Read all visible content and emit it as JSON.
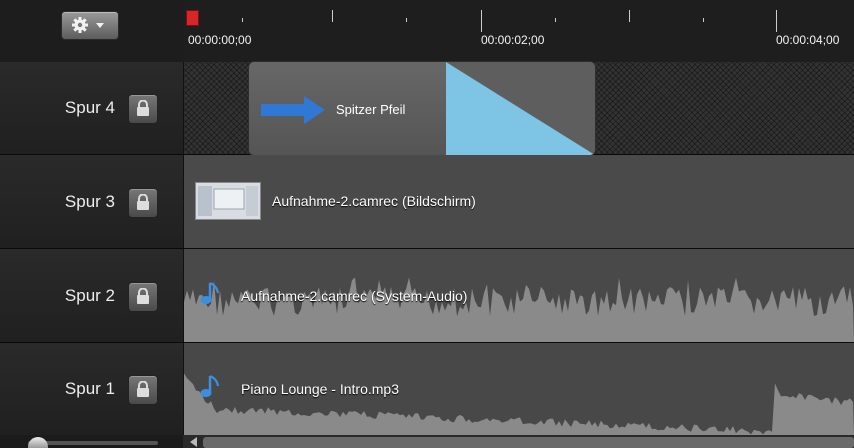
{
  "ruler": {
    "labels": [
      "00:00:00;00",
      "00:00:02;00",
      "00:00:04;00"
    ]
  },
  "tracks": [
    {
      "label": "Spur 4",
      "clip": {
        "label": "Spitzer Pfeil",
        "icon": "arrow-right-icon"
      }
    },
    {
      "label": "Spur 3",
      "clip": {
        "label": "Aufnahme-2.camrec (Bildschirm)",
        "icon": "screen-thumbnail"
      }
    },
    {
      "label": "Spur 2",
      "clip": {
        "label": "Aufnahme-2.camrec (System-Audio)",
        "icon": "music-note-icon"
      }
    },
    {
      "label": "Spur 1",
      "clip": {
        "label": "Piano Lounge - Intro.mp3",
        "icon": "music-note-icon"
      }
    }
  ],
  "icons": {
    "settings": "gear-icon",
    "dropdown": "chevron-down-icon",
    "lock": "lock-icon"
  },
  "colors": {
    "playhead": "#d8252a",
    "arrow": "#2f78d4",
    "transition": "#7ec4e4",
    "music_note": "#3b8fe0"
  }
}
